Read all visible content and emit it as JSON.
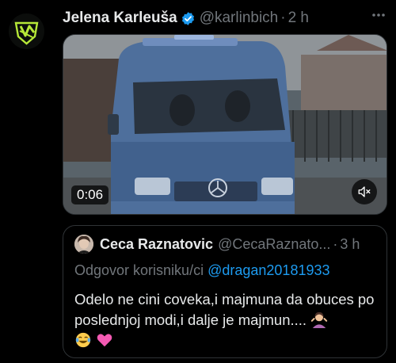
{
  "tweet": {
    "display_name": "Jelena Karleuša",
    "handle": "@karlinbich",
    "separator": "·",
    "time": "2 h",
    "more_icon": "more-horizontal-icon",
    "verified_color": "#1d9bf0",
    "avatar_icon": "green-logo-avatar",
    "video": {
      "duration": "0:06",
      "mute_icon": "speaker-muted-icon"
    },
    "quote": {
      "display_name": "Ceca Raznatovic",
      "handle": "@CecaRaznato...",
      "separator": "·",
      "time": "3 h",
      "reply_prefix": "Odgovor korisniku/ci",
      "reply_mention": "@dragan20181933",
      "text": "Odelo ne cini coveka,i majmuna da obuces po poslednjoj modi,i dalje je majmun....",
      "emojis": [
        "woman-shrugging-emoji",
        "laughing-tears-emoji",
        "pink-heart-emoji"
      ]
    }
  },
  "colors": {
    "background": "#000000",
    "text_primary": "#e7e9ea",
    "text_secondary": "#71767b",
    "link": "#1d9bf0",
    "border": "#2f3336"
  }
}
